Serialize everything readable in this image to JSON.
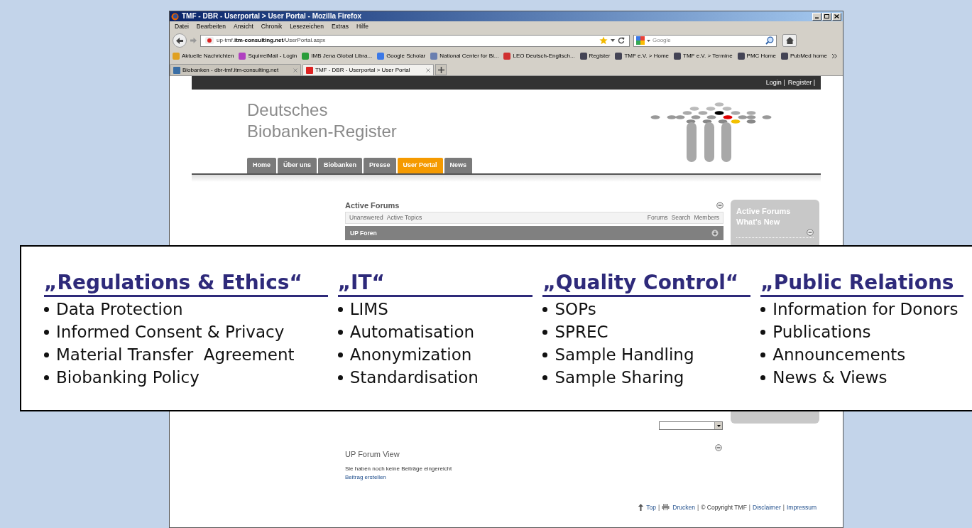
{
  "window": {
    "title": "TMF - DBR - Userportal > User Portal - Mozilla Firefox"
  },
  "menu": [
    "Datei",
    "Bearbeiten",
    "Ansicht",
    "Chronik",
    "Lesezeichen",
    "Extras",
    "Hilfe"
  ],
  "address_bar": {
    "url": "up-tmf.**itm-consulting.net**/UserPortal.aspx"
  },
  "search": {
    "placeholder": "Google"
  },
  "bookmarks": [
    "Aktuelle Nachrichten",
    "SquirrelMail - Login",
    "IMB Jena Global Libra...",
    "Google Scholar",
    "National Center for Bi...",
    "LEO Deutsch-Englisch...",
    "Register",
    "TMF e.V. > Home",
    "TMF e.V. > Termine",
    "PMC Home",
    "PubMed home"
  ],
  "browser_tabs": [
    {
      "label": "Biobanken - dbr-tmf.itm-consulting.net",
      "selected": false
    },
    {
      "label": "TMF - DBR - Userportal > User Portal",
      "selected": true
    }
  ],
  "top_links": [
    "Login |",
    "Register |"
  ],
  "logo": {
    "line_1": "Deutsches",
    "line_2": "Biobanken-Register"
  },
  "nav": [
    {
      "label": "Home",
      "selected": false
    },
    {
      "label": "Über uns",
      "selected": false
    },
    {
      "label": "Biobanken",
      "selected": false
    },
    {
      "label": "Presse",
      "selected": false
    },
    {
      "label": "User Portal",
      "selected": true
    },
    {
      "label": "News",
      "selected": false
    }
  ],
  "active_forums": {
    "title": "Active Forums",
    "links_left": [
      "Unanswered",
      "Active Topics"
    ],
    "links_right": [
      "Forums",
      "Search",
      "Members"
    ],
    "group": "UP Foren"
  },
  "sidebar": {
    "title_lines": [
      "Active Forums",
      "What's New"
    ]
  },
  "forum_view": {
    "title": "UP Forum View",
    "message": "Sie haben noch keine Beiträge eingereicht",
    "link": "Beitrag erstellen"
  },
  "footer": [
    {
      "kind": "top",
      "text": "Top"
    },
    {
      "kind": "sep",
      "text": "|"
    },
    {
      "kind": "print",
      "text": "Drucken"
    },
    {
      "kind": "sep",
      "text": "|"
    },
    {
      "kind": "text",
      "text": "© Copyright TMF"
    },
    {
      "kind": "sep",
      "text": "|"
    },
    {
      "kind": "link",
      "text": "Disclaimer"
    },
    {
      "kind": "sep",
      "text": "|"
    },
    {
      "kind": "link",
      "text": "Impressum"
    }
  ],
  "callout": {
    "columns": [
      {
        "title": "„Regulations & Ethics“",
        "items": [
          "Data Protection",
          "Informed Consent & Privacy",
          "Material Transfer  Agreement",
          "Biobanking Policy"
        ]
      },
      {
        "title": "„IT“",
        "items": [
          "LIMS",
          "Automatisation",
          "Anonymization",
          "Standardisation"
        ]
      },
      {
        "title": "„Quality Control“",
        "items": [
          "SOPs",
          "SPREC",
          "Sample Handling",
          "Sample Sharing"
        ]
      },
      {
        "title": "„Public Relations",
        "items": [
          "Information for Donors",
          "Publications",
          "Announcements",
          "News & Views"
        ]
      }
    ]
  }
}
